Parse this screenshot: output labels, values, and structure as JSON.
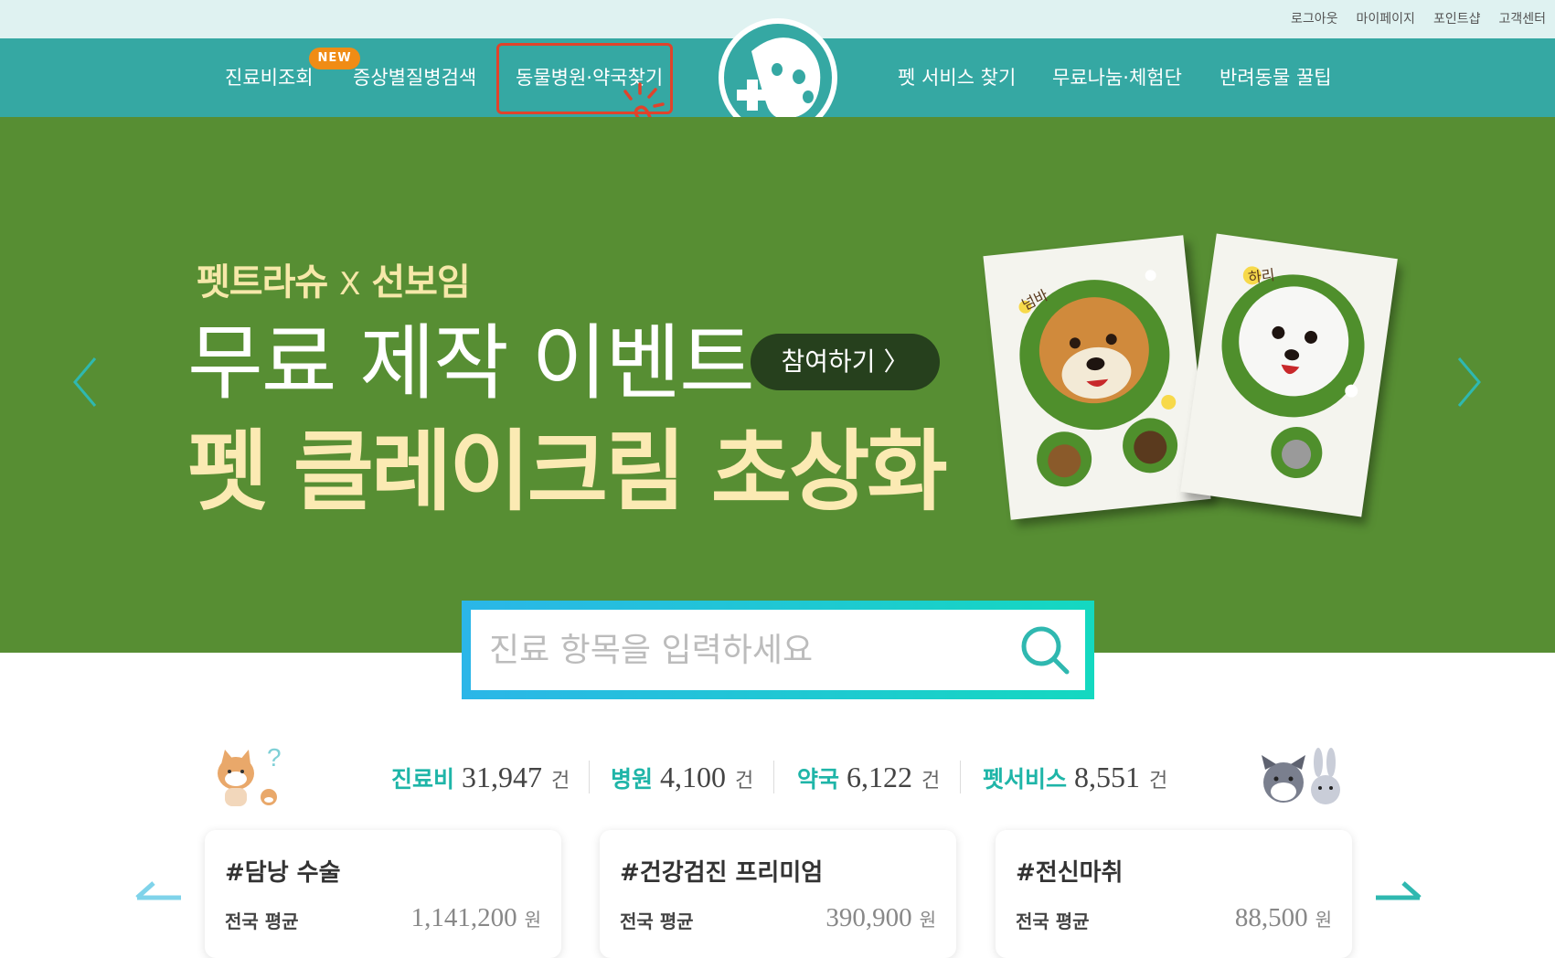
{
  "top_links": [
    "로그아웃",
    "마이페이지",
    "포인트샵",
    "고객센터"
  ],
  "nav": {
    "items_left": [
      "진료비조회",
      "증상별질병검색",
      "동물병원·약국찾기"
    ],
    "items_right": [
      "펫 서비스 찾기",
      "무료나눔·체험단",
      "반려동물 꿀팁"
    ],
    "new_badge": "NEW"
  },
  "hero": {
    "subtitle_left": "펫트라슈",
    "subtitle_x": "X",
    "subtitle_right": "선보임",
    "title_line1": "무료 제작 이벤트",
    "title_line2": "펫 클레이크림 초상화",
    "join_button": "참여하기 〉",
    "canvas_labels": [
      "넘바",
      "하리"
    ]
  },
  "search": {
    "placeholder": "진료 항목을 입력하세요"
  },
  "stats": [
    {
      "label": "진료비",
      "value": "31,947",
      "unit": "건"
    },
    {
      "label": "병원",
      "value": "4,100",
      "unit": "건"
    },
    {
      "label": "약국",
      "value": "6,122",
      "unit": "건"
    },
    {
      "label": "펫서비스",
      "value": "8,551",
      "unit": "건"
    }
  ],
  "cards": [
    {
      "title": "#담낭 수술",
      "avg_label": "전국 평균",
      "price": "1,141,200",
      "unit": "원"
    },
    {
      "title": "#건강검진  프리미엄",
      "avg_label": "전국 평균",
      "price": "390,900",
      "unit": "원"
    },
    {
      "title": "#전신마취",
      "avg_label": "전국 평균",
      "price": "88,500",
      "unit": "원"
    }
  ],
  "colors": {
    "nav_bg": "#35a8a3",
    "hero_bg": "#578e33",
    "accent_teal": "#1fb5a8",
    "highlight_red": "#e0432b",
    "badge_orange": "#f08c15"
  },
  "icons": [
    "paw-plus-logo-icon",
    "pointing-hand-icon",
    "chevron-left-icon",
    "chevron-right-icon",
    "search-icon",
    "arrow-left-icon",
    "arrow-right-icon",
    "dog-question-illustration",
    "dog-bunny-illustration"
  ]
}
